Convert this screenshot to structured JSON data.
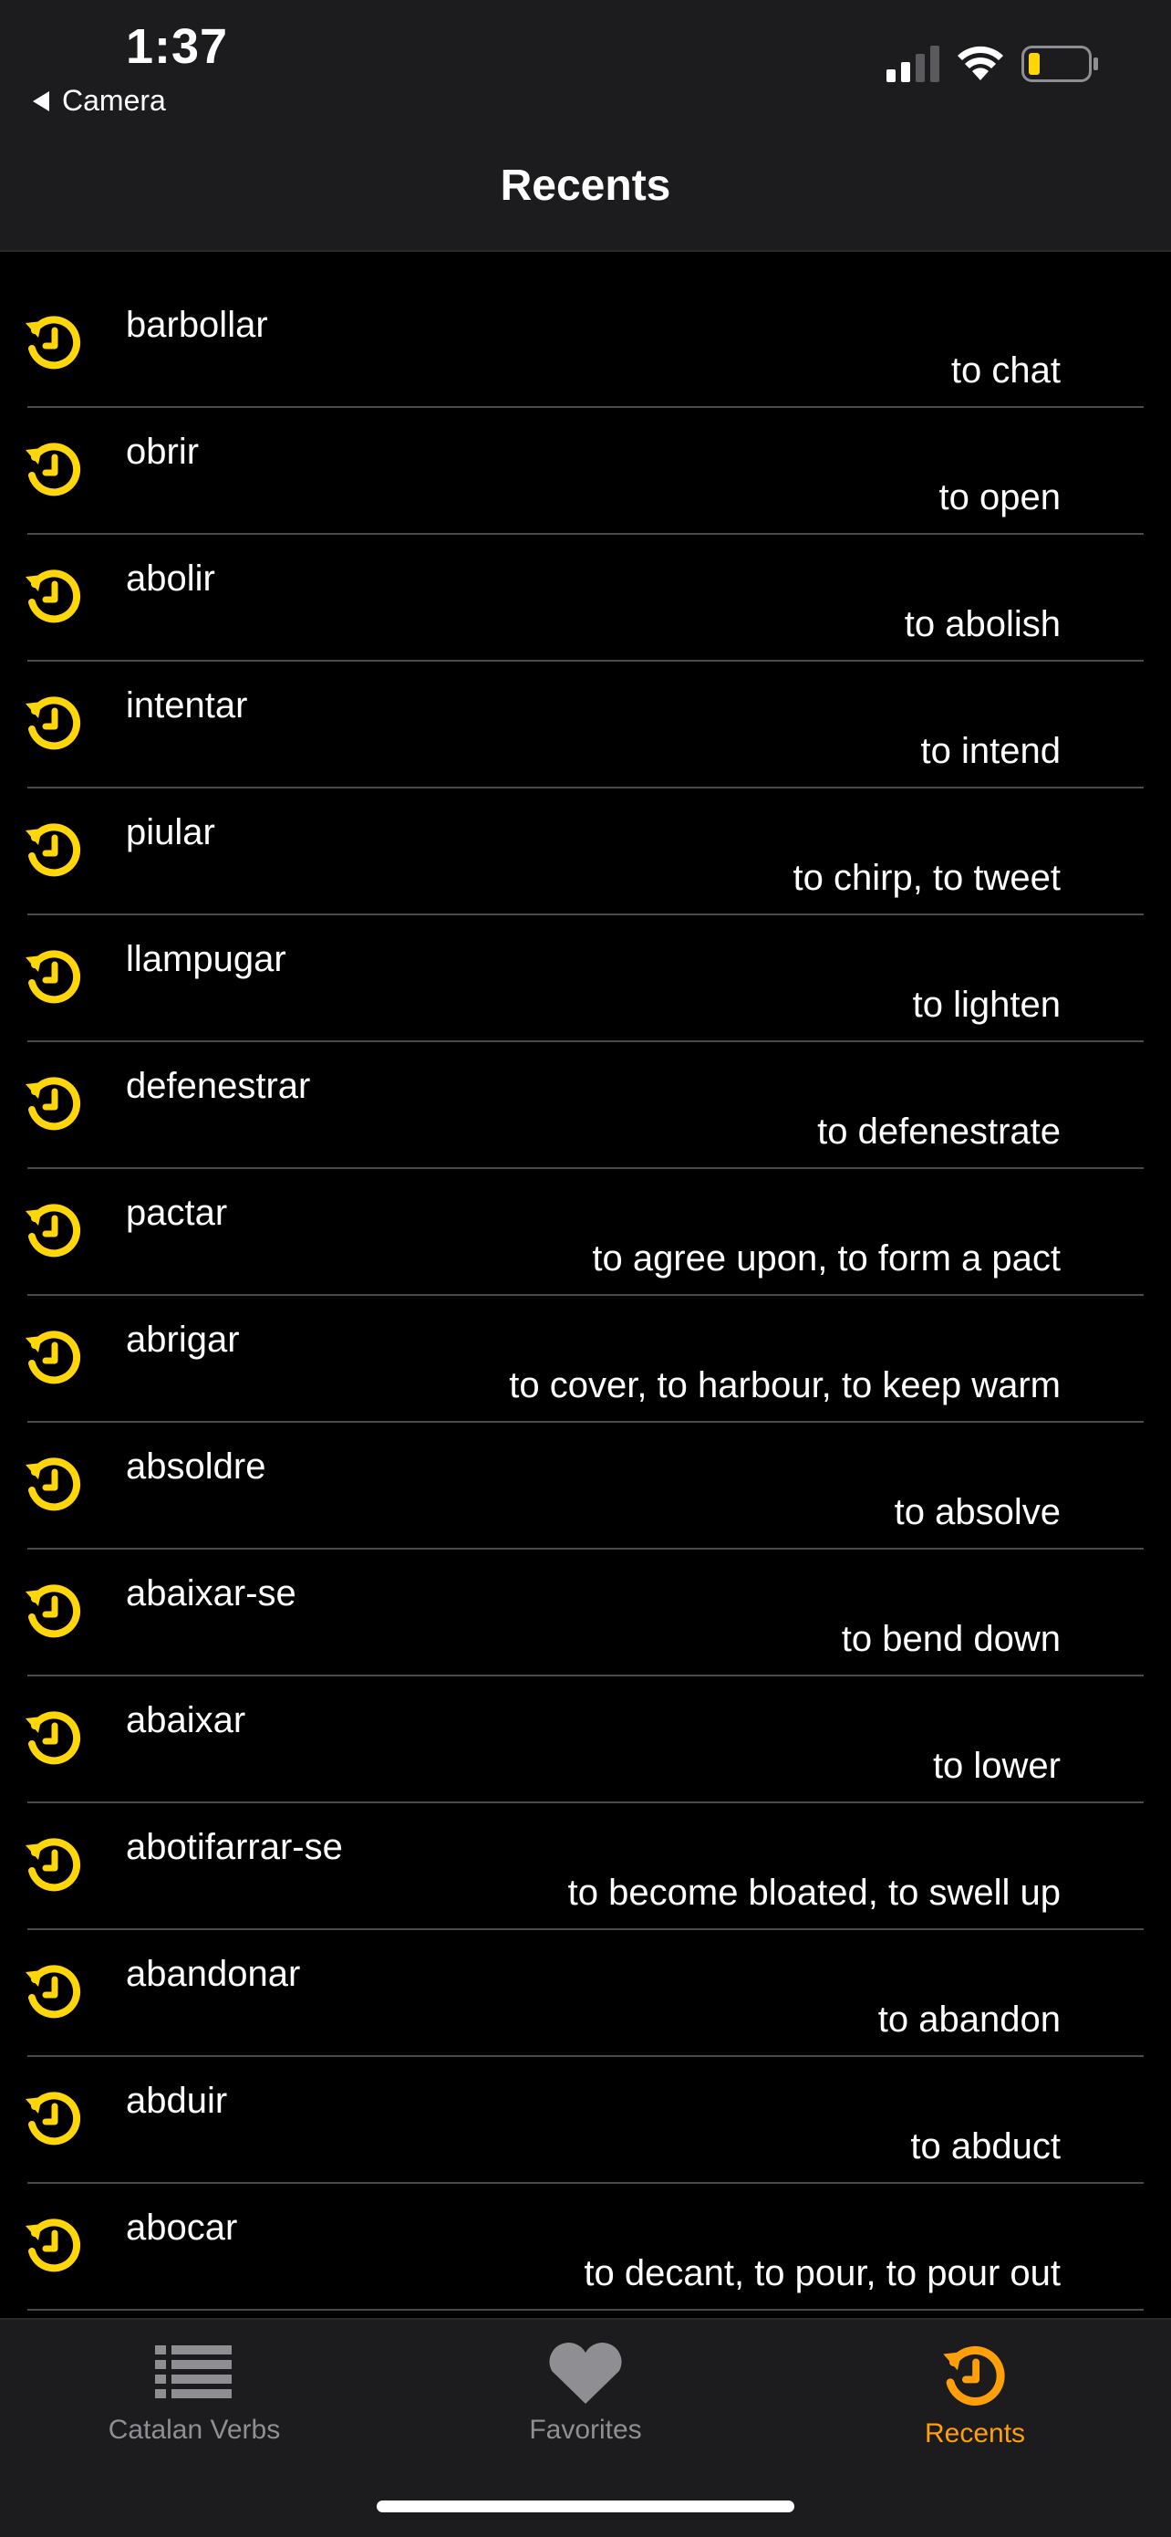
{
  "status_bar": {
    "time": "1:37",
    "back_label": "Camera"
  },
  "nav": {
    "title": "Recents"
  },
  "colors": {
    "accent": "#ffd60a",
    "tab_active": "#ff9f0a",
    "tab_inactive": "#8e8e93"
  },
  "recents": [
    {
      "verb": "barbollar",
      "translation": "to chat"
    },
    {
      "verb": "obrir",
      "translation": "to open"
    },
    {
      "verb": "abolir",
      "translation": "to abolish"
    },
    {
      "verb": "intentar",
      "translation": "to intend"
    },
    {
      "verb": "piular",
      "translation": "to chirp, to tweet"
    },
    {
      "verb": "llampugar",
      "translation": "to lighten"
    },
    {
      "verb": "defenestrar",
      "translation": "to defenestrate"
    },
    {
      "verb": "pactar",
      "translation": "to agree upon, to form a pact"
    },
    {
      "verb": "abrigar",
      "translation": "to cover, to harbour, to keep warm"
    },
    {
      "verb": "absoldre",
      "translation": "to absolve"
    },
    {
      "verb": "abaixar-se",
      "translation": "to bend down"
    },
    {
      "verb": "abaixar",
      "translation": "to lower"
    },
    {
      "verb": "abotifarrar-se",
      "translation": "to become bloated, to swell up"
    },
    {
      "verb": "abandonar",
      "translation": "to abandon"
    },
    {
      "verb": "abduir",
      "translation": "to abduct"
    },
    {
      "verb": "abocar",
      "translation": "to decant, to pour, to pour out"
    }
  ],
  "tabbar": {
    "tabs": [
      {
        "label": "Catalan Verbs",
        "icon": "list-icon",
        "active": false
      },
      {
        "label": "Favorites",
        "icon": "heart-icon",
        "active": false
      },
      {
        "label": "Recents",
        "icon": "history-icon",
        "active": true
      }
    ]
  }
}
